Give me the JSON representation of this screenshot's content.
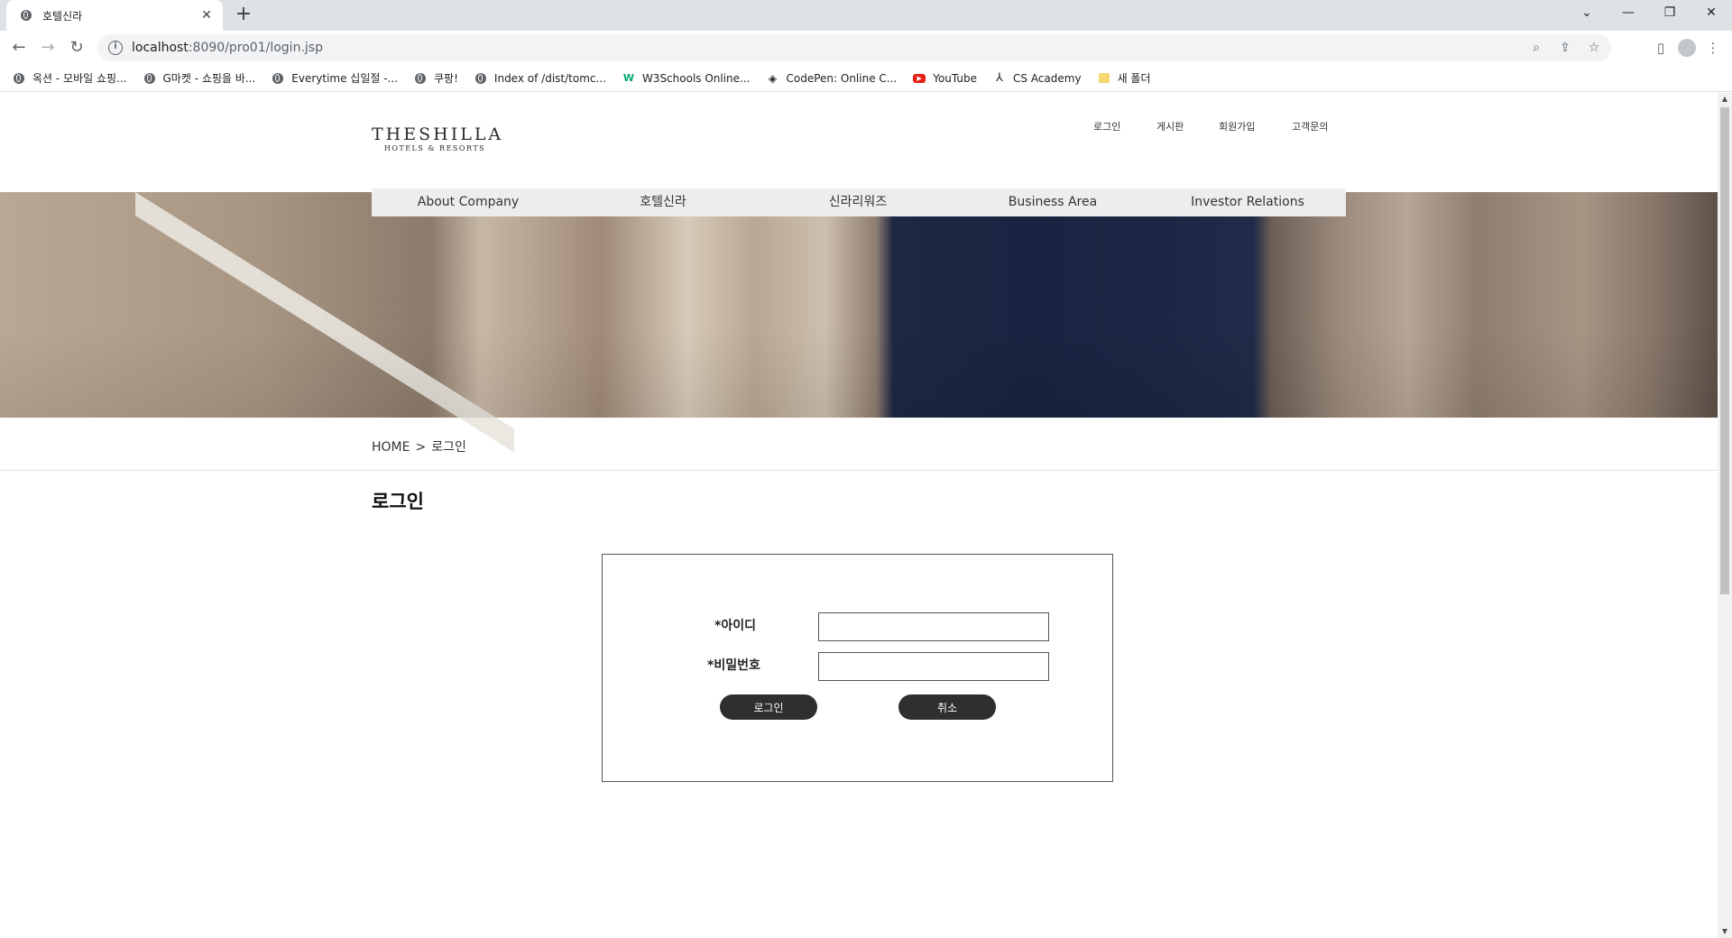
{
  "browser": {
    "tab_title": "호텔신라",
    "url_host": "localhost",
    "url_path": ":8090/pro01/login.jsp",
    "bookmarks": [
      {
        "label": "옥션 - 모바일 쇼핑...",
        "icon": "globe-icon"
      },
      {
        "label": "G마켓 - 쇼핑을 바...",
        "icon": "globe-icon"
      },
      {
        "label": "Everytime 십일절 -...",
        "icon": "globe-icon"
      },
      {
        "label": "쿠팡!",
        "icon": "globe-icon"
      },
      {
        "label": "Index of /dist/tomc...",
        "icon": "globe-icon"
      },
      {
        "label": "W3Schools Online...",
        "icon": "w3schools-icon"
      },
      {
        "label": "CodePen: Online C...",
        "icon": "codepen-icon"
      },
      {
        "label": "YouTube",
        "icon": "youtube-icon"
      },
      {
        "label": "CS Academy",
        "icon": "cs-academy-icon"
      },
      {
        "label": "새 폴더",
        "icon": "folder-icon"
      }
    ]
  },
  "site": {
    "logo_line1": "THESHILLA",
    "logo_line2": "HOTELS & RESORTS",
    "util_nav": [
      "로그인",
      "게시판",
      "회원가입",
      "고객문의"
    ],
    "main_nav": [
      "About Company",
      "호텔신라",
      "신라리워즈",
      "Business Area",
      "Investor Relations"
    ],
    "breadcrumb": {
      "home": "HOME",
      "separator": ">",
      "current": "로그인"
    },
    "page_title": "로그인",
    "login": {
      "id_label": "*아이디",
      "id_value": "",
      "pw_label": "*비밀번호",
      "pw_value": "",
      "submit_label": "로그인",
      "cancel_label": "취소"
    }
  },
  "colors": {
    "nav_bg": "#ededed",
    "button_bg": "#2f2f2f",
    "hero_sky": "#1b2744"
  }
}
